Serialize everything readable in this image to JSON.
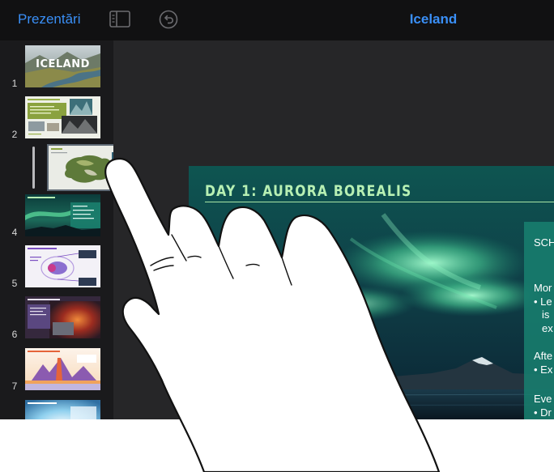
{
  "toolbar": {
    "back_label": "Prezentări",
    "document_title": "Iceland",
    "icons": [
      "sidebar-toggle-icon",
      "undo-icon"
    ]
  },
  "navigator": {
    "slides": [
      {
        "number": "1",
        "title_text": "ICELAND"
      },
      {
        "number": "2"
      },
      {
        "number": "4"
      },
      {
        "number": "5"
      },
      {
        "number": "6"
      },
      {
        "number": "7"
      }
    ],
    "dragged_slide": {
      "state": "being-dragged"
    }
  },
  "slide": {
    "heading": "DAY 1: AURORA BOREALIS",
    "panel_lines": [
      "SCH",
      "Mor",
      "• Le",
      "is",
      "ex",
      "Afte",
      "• Ex",
      "Eve",
      "• Dr"
    ]
  },
  "colors": {
    "accent": "#3a8ff6",
    "toolbar_bg": "#111112",
    "heading": "#b7f0b3",
    "panel": "#187e6e"
  }
}
